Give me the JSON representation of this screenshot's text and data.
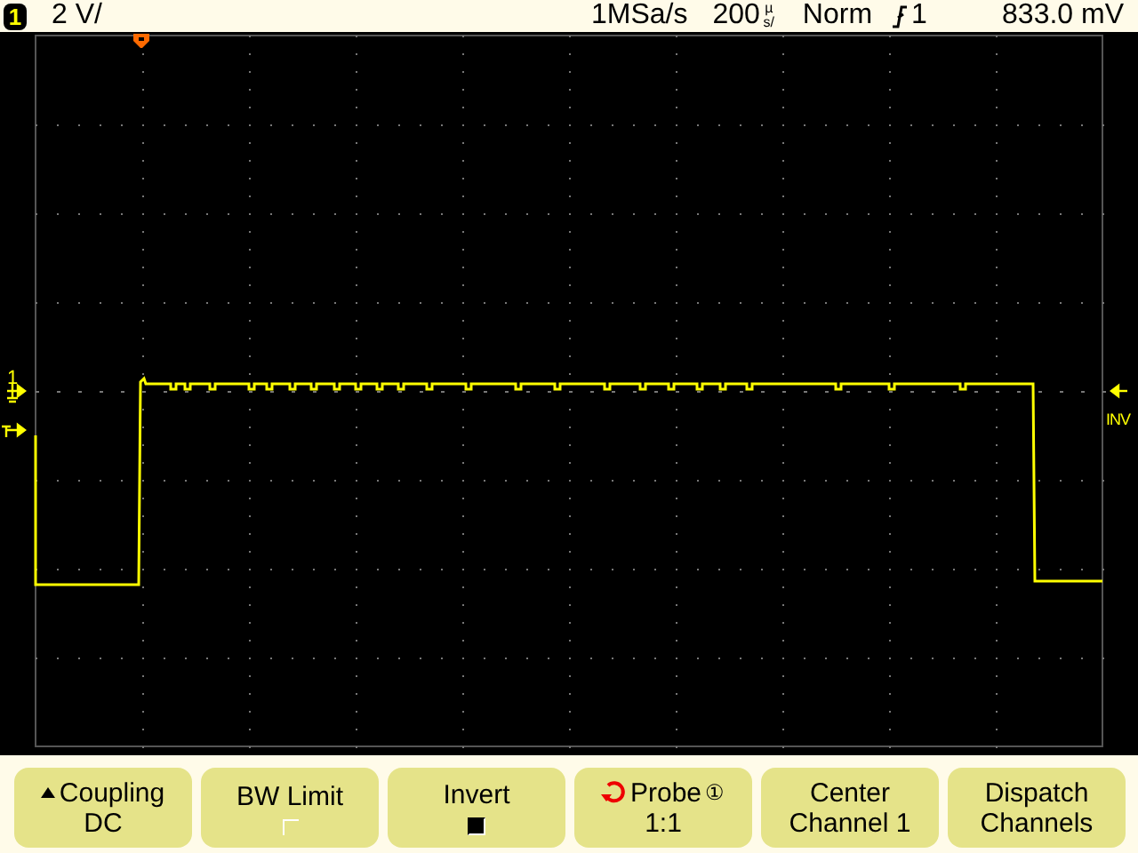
{
  "status_bar": {
    "channel": "1",
    "vertical_scale": "2 V/",
    "sample_rate": "1MSa/s",
    "time_scale": "200",
    "time_unit": "µs/",
    "trigger_mode": "Norm",
    "trigger_source": "1",
    "trigger_level": "833.0 mV"
  },
  "markers": {
    "channel_label": "1",
    "inverted_label": "INV"
  },
  "softkeys": [
    {
      "kind": "menu",
      "label": "Coupling",
      "value": "DC"
    },
    {
      "kind": "checkbox",
      "label": "BW Limit",
      "checked": false
    },
    {
      "kind": "checkbox",
      "label": "Invert",
      "checked": true
    },
    {
      "kind": "knob",
      "label": "Probe",
      "suffix": "①",
      "value": "1:1"
    },
    {
      "kind": "action",
      "label": "Center",
      "value": "Channel 1"
    },
    {
      "kind": "action",
      "label": "Dispatch",
      "value": "Channels"
    }
  ]
}
